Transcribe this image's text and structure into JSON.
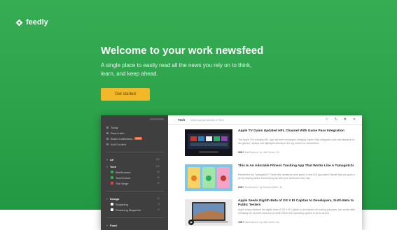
{
  "brand": {
    "name": "feedly"
  },
  "hero": {
    "headline": "Welcome to your work newsfeed",
    "subhead": "A single place to easily read all the news you rely on to think, learn, and keep ahead.",
    "cta_label": "Get started"
  },
  "sidebar": {
    "nav": [
      {
        "label": "Today"
      },
      {
        "label": "Read Later"
      },
      {
        "label": "Board Collections",
        "badge": "PRO"
      },
      {
        "label": "Add Content"
      }
    ],
    "all": {
      "label": "All",
      "count": "130"
    },
    "folders": [
      {
        "label": "Tech",
        "count": "110",
        "feeds": [
          {
            "label": "MacRumors",
            "count": "50",
            "color": "#2bb24c"
          },
          {
            "label": "TechCrunch",
            "count": "40",
            "color": "#2bb24c"
          },
          {
            "label": "The Verge",
            "count": "20",
            "color": "#e8463d"
          }
        ]
      },
      {
        "label": "Design",
        "count": "20",
        "feeds": [
          {
            "label": "Smashing",
            "count": "8",
            "color": "#ffffff"
          },
          {
            "label": "Smashing Magazine",
            "count": "12",
            "color": "#ffffff"
          }
        ]
      },
      {
        "label": "Food",
        "count": "",
        "feeds": []
      }
    ]
  },
  "toolbar": {
    "tab_label": "Tech",
    "crumb": "Most popular articles in Tech",
    "icons": [
      "check-icon",
      "refresh-icon",
      "settings-icon",
      "close-icon"
    ]
  },
  "articles": [
    {
      "title": "Apple TV Gains Updated HFL Channel With Game Pass Integration",
      "snippet": "The Apple TV's existing NFL app has been revamped, bringing Game Pass integration and new features for live games, replays and highlights directly to the big screen for subscribers.",
      "meta": "MacRumors / by Juli Clover / 2h",
      "source": "30K+"
    },
    {
      "title": "This Is An Adorable Fitness Tracking App That Works Like A Tamagotchi",
      "snippet": "Remember the Tamagotchi? These little creatures were great. A new iOS app called Tamafit lets you grow a pet by staying active and keeping up with your workouts every day.",
      "meta": "TechCrunch / by Romain Dillet / 4h",
      "source": "20K+"
    },
    {
      "title": "Apple Seeds Eighth Beta of OS X El Capitan to Developers, Sixth Beta to Public Testers",
      "snippet": "Apple today released the eighth beta of OS X El Capitan to developers for testing purposes, two weeks after releasing the seventh beta and a month before the operating system is set to launch.",
      "meta": "MacRumors / by Juli Clover / 6h",
      "source": "10K+"
    }
  ]
}
